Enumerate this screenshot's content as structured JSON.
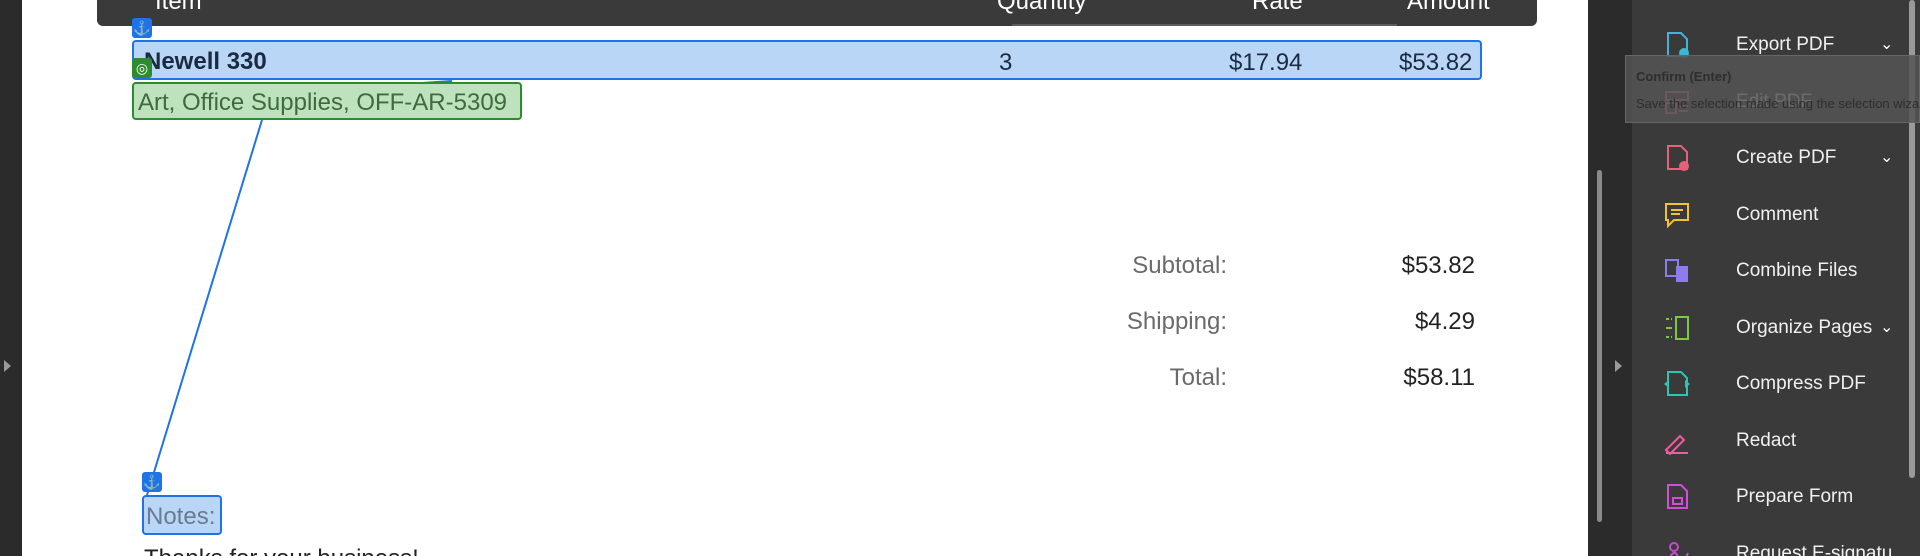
{
  "table_header": {
    "item": "Item",
    "quantity": "Quantity",
    "rate": "Rate",
    "amount": "Amount"
  },
  "line_item": {
    "name": "Newell 330",
    "quantity": "3",
    "rate": "$17.94",
    "amount": "$53.82",
    "description": "Art, Office Supplies, OFF-AR-5309"
  },
  "totals": {
    "subtotal_label": "Subtotal:",
    "subtotal_value": "$53.82",
    "shipping_label": "Shipping:",
    "shipping_value": "$4.29",
    "total_label": "Total:",
    "total_value": "$58.11"
  },
  "notes": {
    "label": "Notes:",
    "text": "Thanks for your business!"
  },
  "badges": {
    "anchor": "⚓",
    "target": "◎"
  },
  "tooltip": {
    "title": "Confirm (Enter)",
    "text": "Save the selection made using the selection wizard"
  },
  "tools": [
    {
      "label": "Export PDF",
      "icon": "export-pdf-icon",
      "color": "#3fb6d6",
      "has_chevron": true
    },
    {
      "label": "Edit PDF",
      "icon": "edit-pdf-icon",
      "color": "#e8708a",
      "has_chevron": false
    },
    {
      "label": "Create PDF",
      "icon": "create-pdf-icon",
      "color": "#e8607a",
      "has_chevron": true
    },
    {
      "label": "Comment",
      "icon": "comment-icon",
      "color": "#f2c230",
      "has_chevron": false
    },
    {
      "label": "Combine Files",
      "icon": "combine-files-icon",
      "color": "#8b7cf0",
      "has_chevron": false
    },
    {
      "label": "Organize Pages",
      "icon": "organize-pages-icon",
      "color": "#7cc840",
      "has_chevron": true
    },
    {
      "label": "Compress PDF",
      "icon": "compress-pdf-icon",
      "color": "#2ec4b4",
      "has_chevron": false
    },
    {
      "label": "Redact",
      "icon": "redact-icon",
      "color": "#e860a0",
      "has_chevron": false
    },
    {
      "label": "Prepare Form",
      "icon": "prepare-form-icon",
      "color": "#d24ed8",
      "has_chevron": false
    },
    {
      "label": "Request E-signatu",
      "icon": "request-esignature-icon",
      "color": "#c848d0",
      "has_chevron": false
    }
  ],
  "chevron_glyph": "⌄"
}
